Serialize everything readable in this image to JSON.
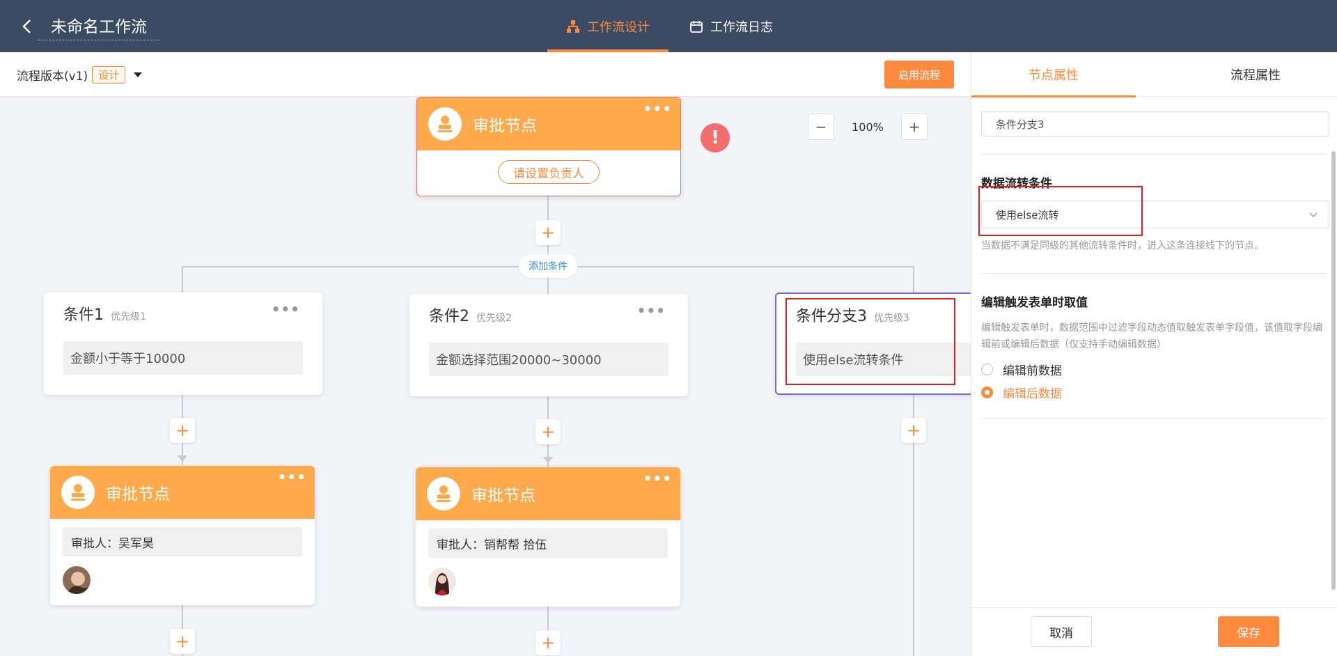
{
  "header": {
    "title": "未命名工作流",
    "tabs": [
      {
        "label": "工作流设计",
        "icon": "workflow-icon",
        "active": true
      },
      {
        "label": "工作流日志",
        "icon": "calendar-icon",
        "active": false
      }
    ],
    "accent_color": "#ff8a3d",
    "bg_color": "#3c4b64"
  },
  "toolbar": {
    "version_label": "流程版本(v1)",
    "version_badge": "设计",
    "enable_label": "启用流程"
  },
  "canvas": {
    "zoom": "100%",
    "zoom_out": "−",
    "zoom_in": "+",
    "warning_glyph": "!",
    "add_condition_label": "添加条件",
    "more_glyph": "•••",
    "plus_glyph": "+",
    "top_node": {
      "title": "审批节点",
      "action": "请设置负责人"
    },
    "branches": [
      {
        "title": "条件1",
        "priority": "优先级1",
        "condition": "金额小于等于10000",
        "node": {
          "title": "审批节点",
          "approver": "审批人：吴军昊"
        }
      },
      {
        "title": "条件2",
        "priority": "优先级2",
        "condition": "金额选择范围20000~30000",
        "node": {
          "title": "审批节点",
          "approver": "审批人：销帮帮 拾伍"
        }
      },
      {
        "title": "条件分支3",
        "priority": "优先级3",
        "condition": "使用else流转条件"
      }
    ]
  },
  "panel": {
    "tabs": [
      {
        "label": "节点属性",
        "active": true
      },
      {
        "label": "流程属性",
        "active": false
      }
    ],
    "name_value": "条件分支3",
    "flow_condition": {
      "heading": "数据流转条件",
      "selected": "使用else流转",
      "hint": "当数据不满足同级的其他流转条件时，进入这条连接线下的节点。"
    },
    "edit_trigger": {
      "heading": "编辑触发表单时取值",
      "hint": "编辑触发表单时，数据范围中过滤字段动态值取触发表单字段值，该值取字段编辑前或编辑后数据（仅支持手动编辑数据）",
      "options": [
        {
          "label": "编辑前数据",
          "checked": false
        },
        {
          "label": "编辑后数据",
          "checked": true
        }
      ]
    },
    "cancel_label": "取消",
    "save_label": "保存"
  }
}
